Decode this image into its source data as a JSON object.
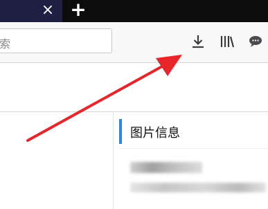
{
  "tabbar": {
    "close_glyph": "×",
    "new_tab_glyph": "+"
  },
  "toolbar": {
    "search_placeholder": "索",
    "icons": [
      "download-icon",
      "library-icon",
      "chat-icon"
    ]
  },
  "panel": {
    "title": "图片信息"
  },
  "colors": {
    "tabbar_bg": "#0c0c0d",
    "active_tab_bg": "#1f1f43",
    "toolbar_bg": "#f9f9fa",
    "accent_blue": "#2a8ae2",
    "arrow_red": "#e8262a"
  }
}
